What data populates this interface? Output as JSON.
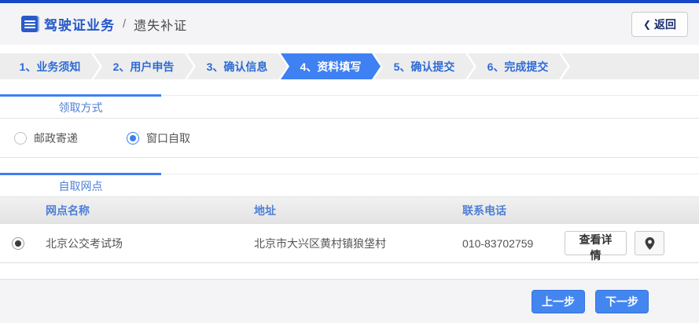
{
  "page": {
    "title": "驾驶证业务",
    "separator": "/",
    "subtitle": "遗失补证",
    "back_chevron": "❮",
    "back_label": "返回"
  },
  "steps": {
    "items": [
      {
        "label": "1、业务须知",
        "active": false
      },
      {
        "label": "2、用户申告",
        "active": false
      },
      {
        "label": "3、确认信息",
        "active": false
      },
      {
        "label": "4、资料填写",
        "active": true
      },
      {
        "label": "5、确认提交",
        "active": false
      },
      {
        "label": "6、完成提交",
        "active": false
      }
    ]
  },
  "pickup": {
    "tab_label": "领取方式",
    "options": [
      {
        "label": "邮政寄递",
        "selected": false
      },
      {
        "label": "窗口自取",
        "selected": true
      }
    ]
  },
  "outlets": {
    "tab_label": "自取网点",
    "columns": [
      "网点名称",
      "地址",
      "联系电话"
    ],
    "rows": [
      {
        "selected": true,
        "name": "北京公交考试场",
        "address": "北京市大兴区黄村镇狼垡村",
        "phone": "010-83702759",
        "detail_label": "查看详情",
        "pin_icon": "location-pin"
      }
    ]
  },
  "footer": {
    "prev_label": "上一步",
    "next_label": "下一步"
  },
  "colors": {
    "topbar_blue": "#1747c4",
    "title_blue": "#2458c5",
    "step_active_blue": "#3f80f2",
    "step_inactive_gray": "#ededee",
    "label_blue": "#4d7fd6",
    "button_blue": "#4486f0",
    "body_text": "#555555"
  }
}
